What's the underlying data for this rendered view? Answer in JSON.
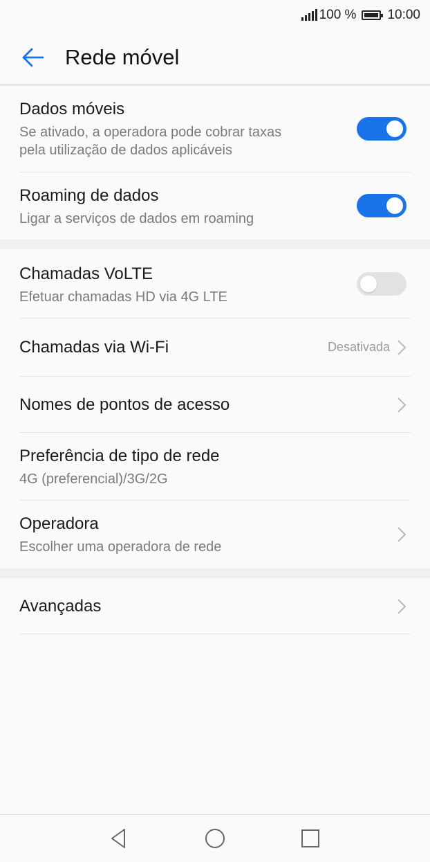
{
  "status_bar": {
    "battery": "100 %",
    "time": "10:00"
  },
  "header": {
    "title": "Rede móvel",
    "back_icon": "arrow-back-icon",
    "accent_color": "#1a73e8"
  },
  "items": [
    {
      "title": "Dados móveis",
      "subtitle_lines": [
        "Se ativado, a operadora pode cobrar taxas",
        "pela utilização de dados aplicáveis"
      ],
      "control": "toggle",
      "toggle_on": true
    },
    {
      "title": "Roaming de dados",
      "subtitle_lines": [
        "Ligar a serviços de dados em roaming"
      ],
      "control": "toggle",
      "toggle_on": true
    },
    {
      "title": "Chamadas VoLTE",
      "subtitle_lines": [
        "Efetuar chamadas HD via 4G LTE"
      ],
      "control": "toggle",
      "toggle_on": false
    },
    {
      "title": "Chamadas via Wi-Fi",
      "value": "Desativada",
      "control": "chevron"
    },
    {
      "title": "Nomes de pontos de acesso",
      "control": "chevron"
    },
    {
      "title": "Preferência de tipo de rede",
      "subtitle_lines": [
        "4G (preferencial)/3G/2G"
      ],
      "control": "none"
    },
    {
      "title": "Operadora",
      "subtitle_lines": [
        "Escolher uma operadora de rede"
      ],
      "control": "chevron"
    },
    {
      "title": "Avançadas",
      "control": "chevron"
    }
  ],
  "nav_bar": {
    "back": "nav-back-icon",
    "home": "nav-home-icon",
    "recents": "nav-recents-icon"
  }
}
